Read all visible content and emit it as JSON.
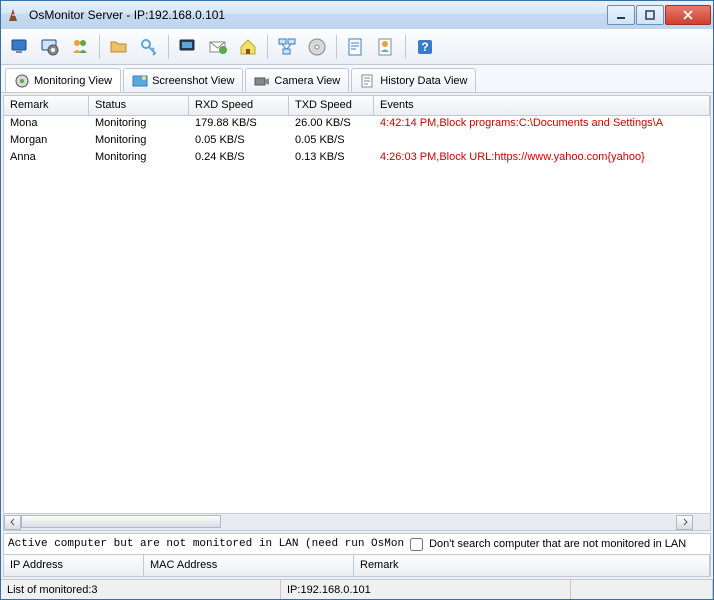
{
  "window": {
    "title": "OsMonitor Server -  IP:192.168.0.101"
  },
  "viewtabs": [
    {
      "label": "Monitoring View"
    },
    {
      "label": "Screenshot View"
    },
    {
      "label": "Camera View"
    },
    {
      "label": "History Data View"
    }
  ],
  "grid": {
    "columns": {
      "remark": "Remark",
      "status": "Status",
      "rxd": "RXD Speed",
      "txd": "TXD Speed",
      "events": "Events"
    },
    "rows": [
      {
        "remark": "Mona",
        "status": "Monitoring",
        "rxd": "179.88 KB/S",
        "txd": "26.00 KB/S",
        "event": "4:42:14 PM,Block programs:C:\\Documents and Settings\\A"
      },
      {
        "remark": "Morgan",
        "status": "Monitoring",
        "rxd": "0.05 KB/S",
        "txd": "0.05 KB/S",
        "event": ""
      },
      {
        "remark": "Anna",
        "status": "Monitoring",
        "rxd": "0.24 KB/S",
        "txd": "0.13 KB/S",
        "event": "4:26:03 PM,Block URL:https://www.yahoo.com{yahoo}"
      }
    ]
  },
  "options": {
    "opt1_label": "Active computer but are not monitored in LAN (need run OsMon",
    "opt2_label": "Don't search computer that are not monitored in LAN"
  },
  "subgrid": {
    "ip": "IP Address",
    "mac": "MAC Address",
    "remark": "Remark"
  },
  "status": {
    "monitored": "List of monitored:3",
    "ip": "IP:192.168.0.101"
  }
}
